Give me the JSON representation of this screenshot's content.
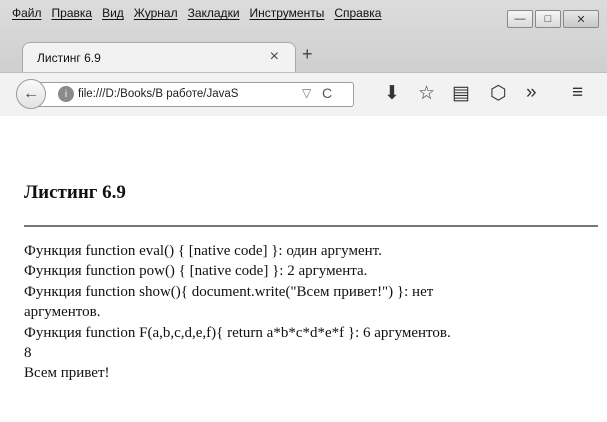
{
  "menubar": {
    "items": [
      "Файл",
      "Правка",
      "Вид",
      "Журнал",
      "Закладки",
      "Инструменты",
      "Справка"
    ]
  },
  "window_controls": {
    "minimize": "—",
    "maximize": "□",
    "close": "✕"
  },
  "tab": {
    "title": "Листинг 6.9",
    "close": "×",
    "new_tab": "+"
  },
  "navbar": {
    "back": "←",
    "url": "file:///D:/Books/В работе/JavaS",
    "dropdown": "▽",
    "reload": "C",
    "download_icon": "⬇",
    "bookmark_icon": "☆",
    "reader_icon": "▤",
    "pocket_icon": "⬡",
    "overflow": "»",
    "menu_icon": "≡"
  },
  "page": {
    "title": "Листинг 6.9",
    "lines": [
      "Функция function eval() { [native code] }: один аргумент.",
      "Функция function pow() { [native code] }: 2 аргумента.",
      "Функция function show(){ document.write(\"Всем привет!\") }: нет",
      "аргументов.",
      "Функция function F(a,b,c,d,e,f){ return a*b*c*d*e*f }: 6 аргументов.",
      "8",
      "Всем привет!"
    ]
  }
}
